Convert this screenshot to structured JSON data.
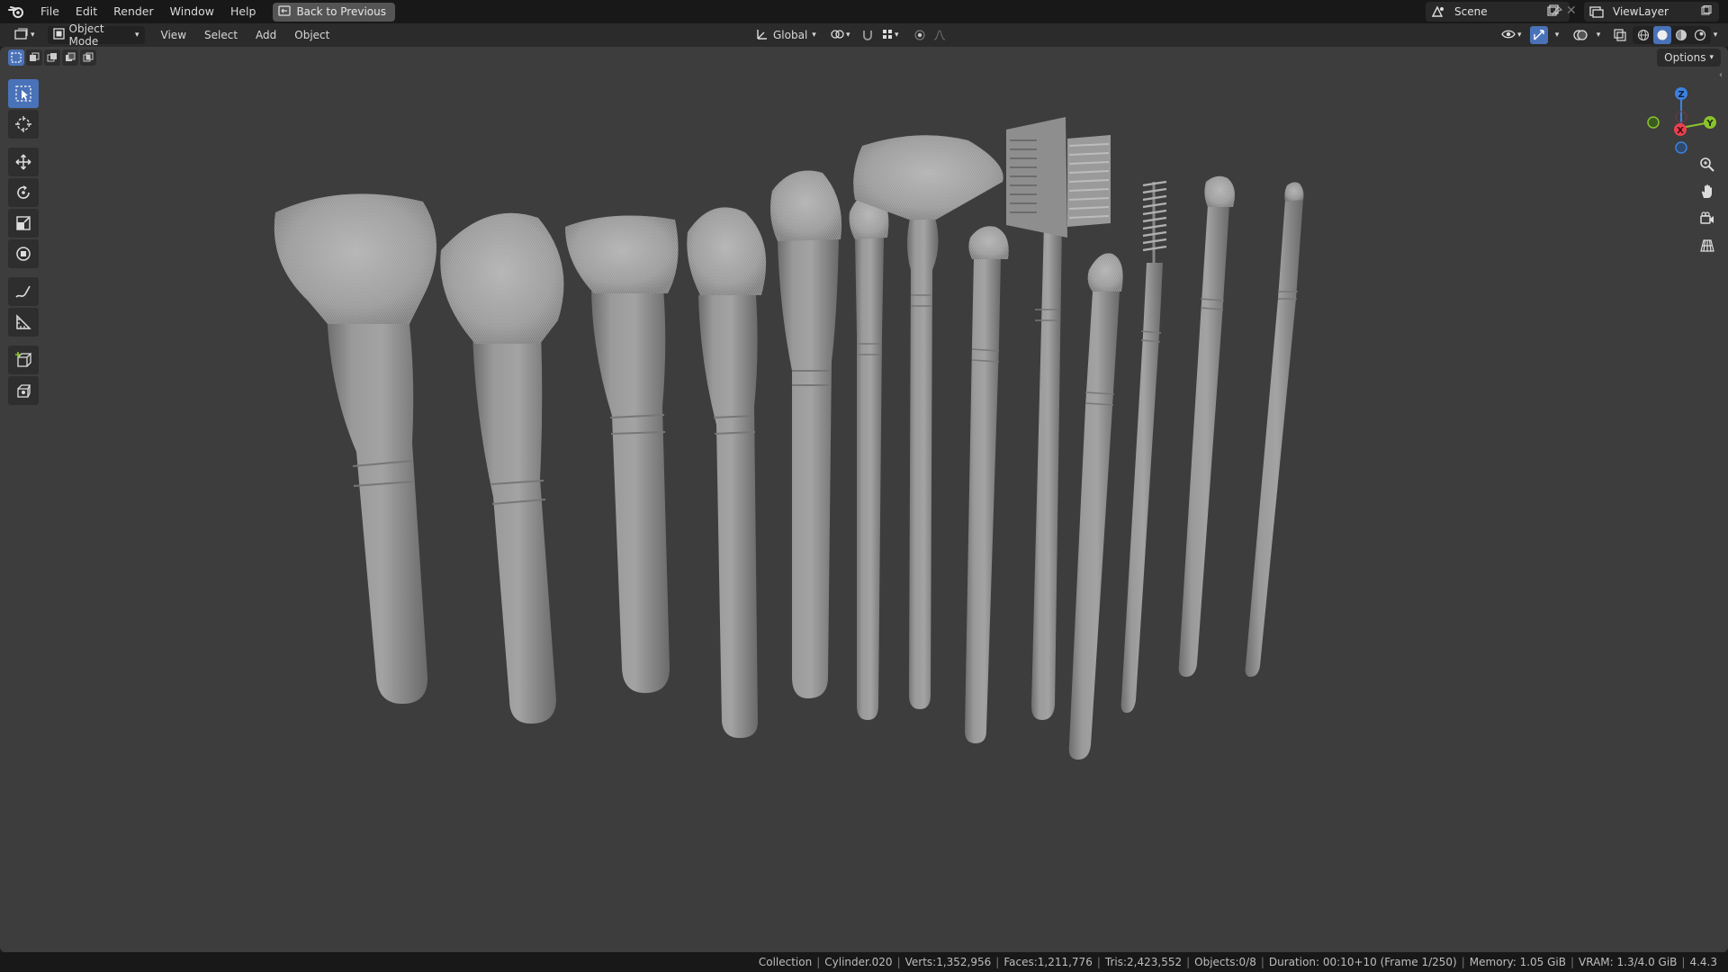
{
  "menu": {
    "items": [
      "File",
      "Edit",
      "Render",
      "Window",
      "Help"
    ],
    "back_button": "Back to Previous"
  },
  "scene": {
    "name": "Scene",
    "view_layer": "ViewLayer"
  },
  "header": {
    "mode": "Object Mode",
    "menus": [
      "View",
      "Select",
      "Add",
      "Object"
    ],
    "transform_orientation": "Global",
    "options": "Options"
  },
  "gizmo": {
    "x": "X",
    "y": "Y",
    "z": "Z"
  },
  "status": {
    "collection": "Collection",
    "object": "Cylinder.020",
    "verts": "Verts:1,352,956",
    "faces": "Faces:1,211,776",
    "tris": "Tris:2,423,552",
    "objects": "Objects:0/8",
    "duration": "Duration: 00:10+10 (Frame 1/250)",
    "memory": "Memory: 1.05 GiB",
    "vram": "VRAM: 1.3/4.0 GiB",
    "version": "4.4.3"
  },
  "colors": {
    "accent": "#4a72b8",
    "axis_x": "#e8404e",
    "axis_y": "#8bc32c",
    "axis_z": "#3c82e0",
    "viewport_bg": "#3d3d3d"
  }
}
